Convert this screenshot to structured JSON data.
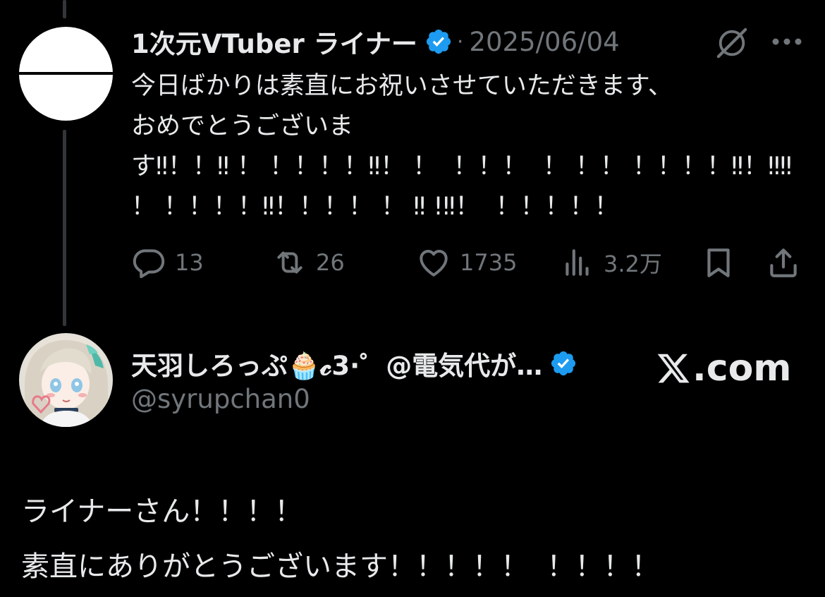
{
  "tweet1": {
    "author_name": "1次元VTuber ライナー",
    "separator": "·",
    "date": "2025/06/04",
    "text_lines": [
      "今日ばかりは素直にお祝いさせていただきます、",
      "おめでとうございま",
      "す‼！！‼ ！ ！！！！‼！ ！  ！！！  ！ ！！ ！！！！‼！‼‼",
      "！ ！！！！‼！！！！ ！ ‼ !‼！  ！！！！！"
    ],
    "stats": {
      "replies": "13",
      "reposts": "26",
      "likes": "1735",
      "views": "3.2万"
    }
  },
  "tweet2": {
    "author_name": "天羽しろっぷ🧁𝓬3·゜@電気代が…",
    "handle": "@syrupchan0",
    "text_lines": [
      "ライナーさん！！！！",
      "素直にありがとうございます！！！！！  ！！！！"
    ]
  },
  "watermark": ".com",
  "colors": {
    "background": "#000000",
    "text": "#e7e9ea",
    "muted": "#71767b",
    "verified": "#1d9bf0"
  }
}
